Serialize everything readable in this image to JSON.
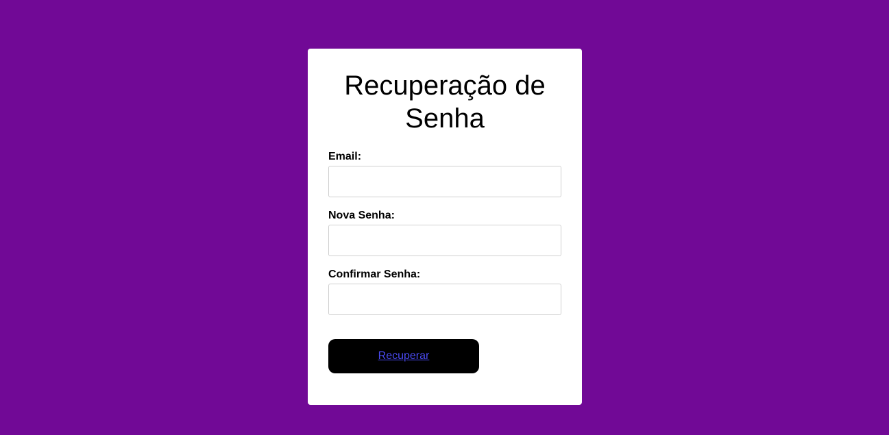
{
  "form": {
    "title": "Recuperação de Senha",
    "email_label": "Email:",
    "email_value": "",
    "new_password_label": "Nova Senha:",
    "new_password_value": "",
    "confirm_password_label": "Confirmar Senha:",
    "confirm_password_value": "",
    "submit_label": "Recuperar"
  },
  "colors": {
    "background": "#710996",
    "card": "#ffffff",
    "button": "#000000",
    "link": "#4a4af0"
  }
}
